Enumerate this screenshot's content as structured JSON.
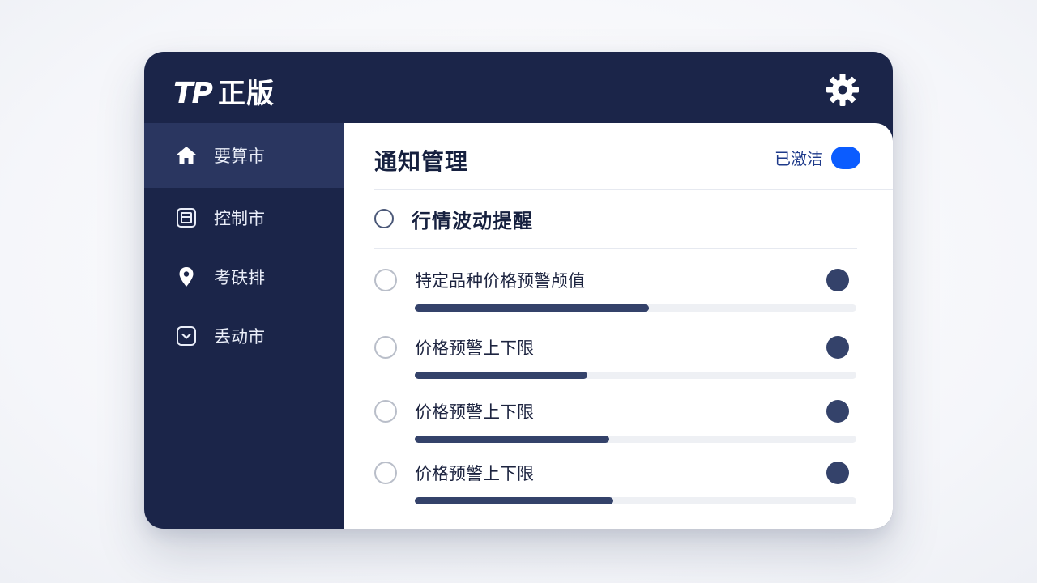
{
  "app": {
    "brand_mark": "TP",
    "brand_name": "正版",
    "settings_icon": "gear-icon"
  },
  "sidebar": {
    "items": [
      {
        "label": "要算市",
        "icon": "home-icon",
        "active": true
      },
      {
        "label": "控制市",
        "icon": "document-icon",
        "active": false
      },
      {
        "label": "考砆排",
        "icon": "location-pin-icon",
        "active": false
      },
      {
        "label": "丢动市",
        "icon": "chevron-down-box-icon",
        "active": false
      }
    ]
  },
  "panel": {
    "title": "通知管理",
    "status_label": "已激洁",
    "status_on": true,
    "group_label": "行情波动提醒",
    "rows": [
      {
        "label": "特定品种价格预警颅值",
        "progress": 0.53
      },
      {
        "label": "价格预警上下限",
        "progress": 0.39
      },
      {
        "label": "价格预警上下限",
        "progress": 0.44
      },
      {
        "label": "价格预警上下限",
        "progress": 0.45
      }
    ]
  },
  "colors": {
    "sidebar_bg": "#1b2549",
    "sidebar_active": "#2a3660",
    "accent": "#0b5cff",
    "progress_fill": "#34426a",
    "progress_track": "#eef0f4"
  }
}
